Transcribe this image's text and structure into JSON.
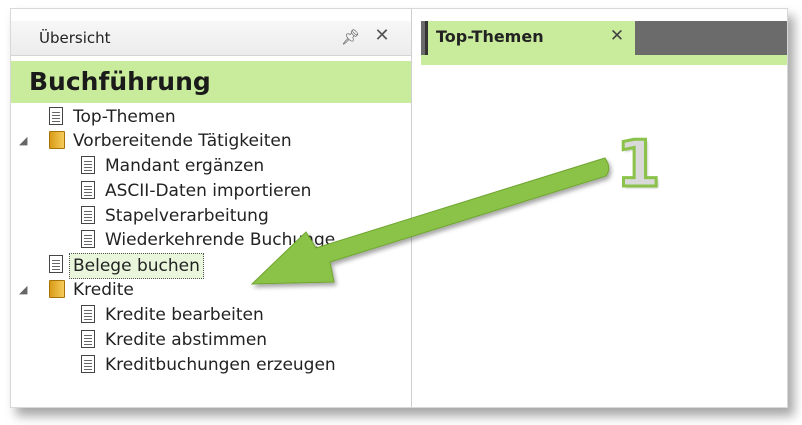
{
  "panel": {
    "title": "Übersicht",
    "pin_icon": "pin-icon",
    "close_icon": "close-icon"
  },
  "section_title": "Buchführung",
  "tree": [
    {
      "label": "Top-Themen",
      "icon": "document-icon",
      "level": 0,
      "expander": ""
    },
    {
      "label": "Vorbereitende Tätigkeiten",
      "icon": "folder-icon",
      "level": 0,
      "expander": "◢"
    },
    {
      "label": "Mandant ergänzen",
      "icon": "document-icon",
      "level": 1,
      "expander": ""
    },
    {
      "label": "ASCII-Daten importieren",
      "icon": "document-icon",
      "level": 1,
      "expander": ""
    },
    {
      "label": "Stapelverarbeitung",
      "icon": "document-icon",
      "level": 1,
      "expander": ""
    },
    {
      "label": "Wiederkehrende Buchunge...",
      "icon": "document-icon",
      "level": 1,
      "expander": ""
    },
    {
      "label": "Belege buchen",
      "icon": "document-icon",
      "level": 0,
      "expander": "",
      "selected": true
    },
    {
      "label": "Kredite",
      "icon": "folder-icon",
      "level": 0,
      "expander": "◢"
    },
    {
      "label": "Kredite bearbeiten",
      "icon": "document-icon",
      "level": 1,
      "expander": ""
    },
    {
      "label": "Kredite abstimmen",
      "icon": "document-icon",
      "level": 1,
      "expander": ""
    },
    {
      "label": "Kreditbuchungen erzeugen",
      "icon": "document-icon",
      "level": 1,
      "expander": ""
    }
  ],
  "tabs": [
    {
      "label": "Top-Themen",
      "close_icon": "close-icon",
      "active": true
    }
  ],
  "annotation": {
    "number": "1",
    "arrow_color": "#8bc34a"
  },
  "colors": {
    "accent_green": "#c9ec9c",
    "tab_strip": "#6b6b6b",
    "arrow": "#8bc34a"
  }
}
